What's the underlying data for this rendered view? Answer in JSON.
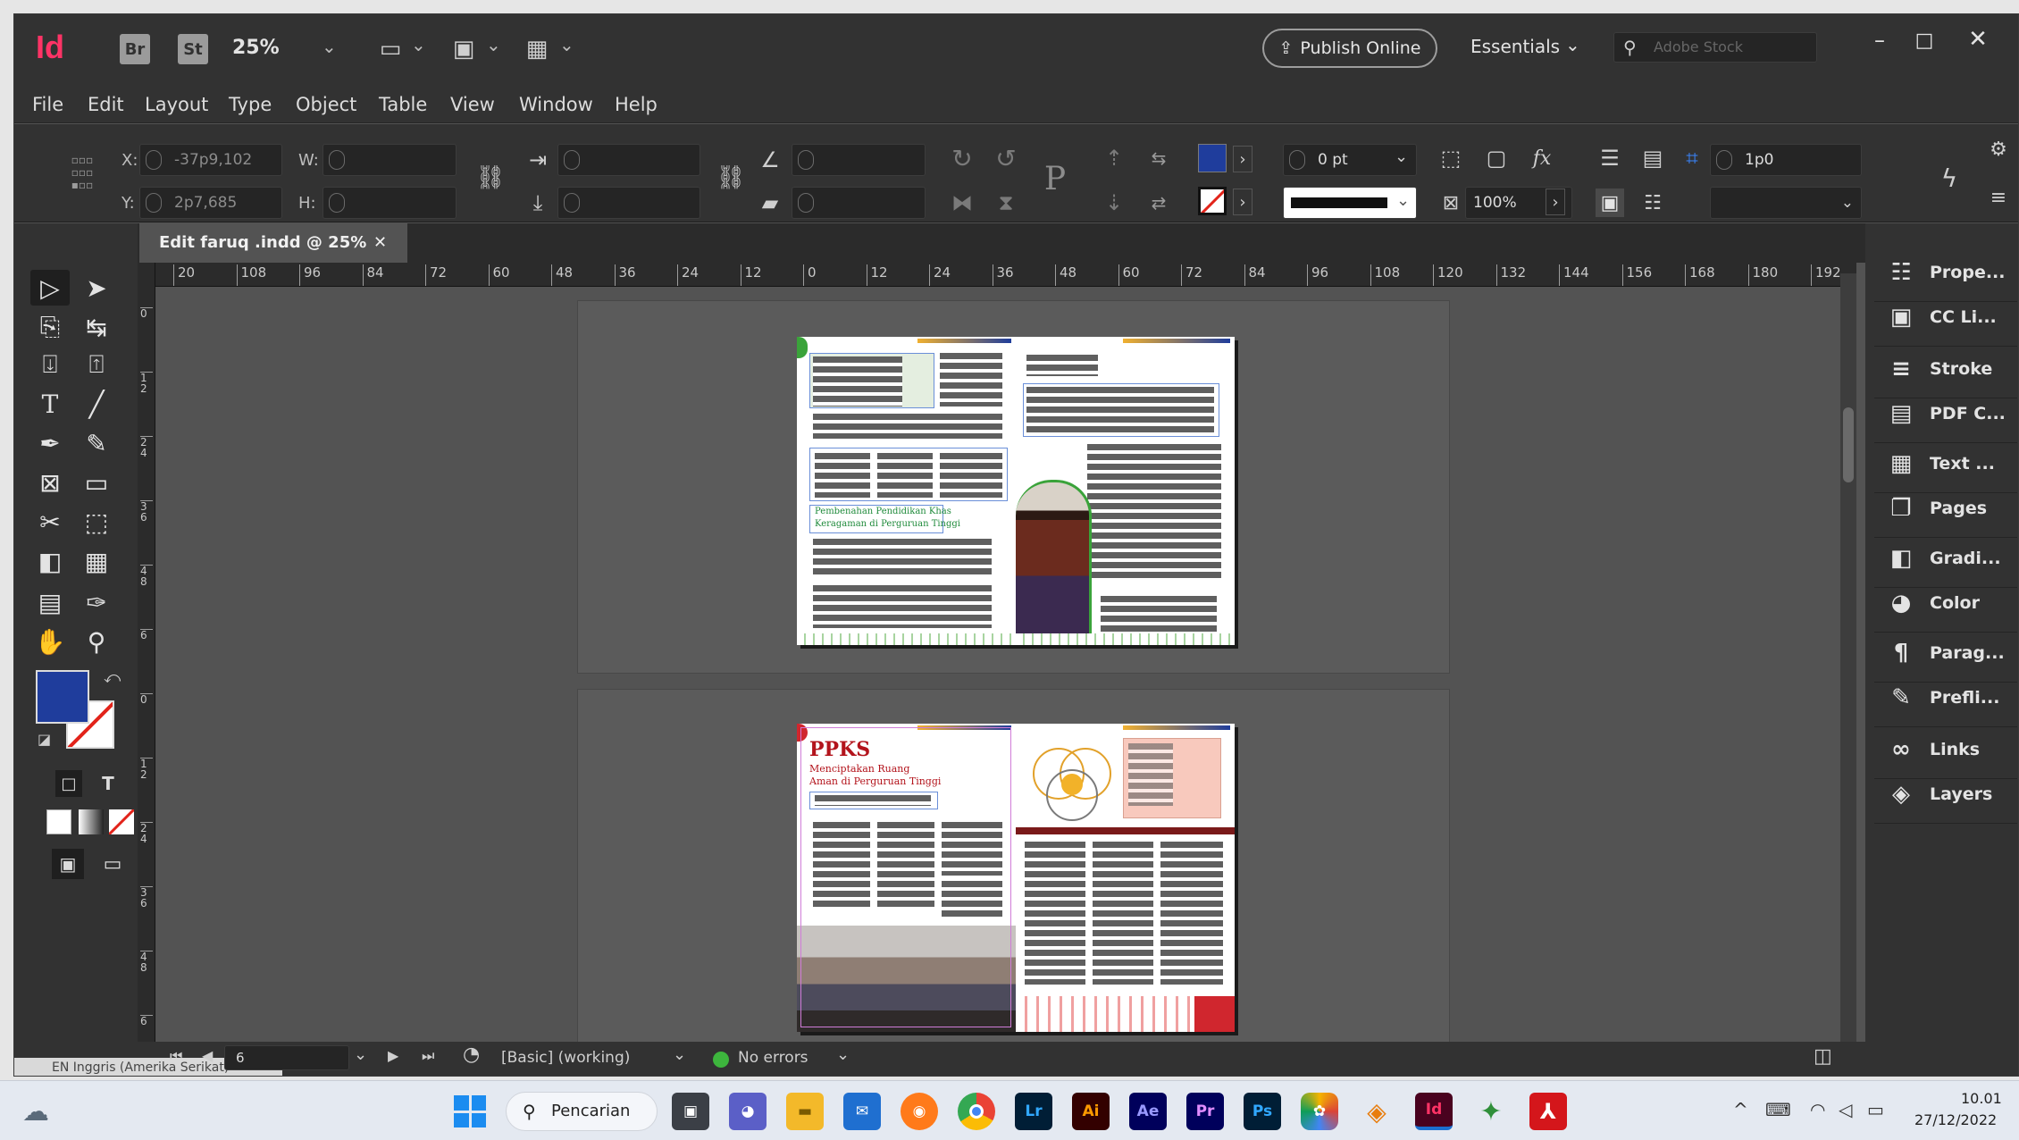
{
  "app": {
    "logo": "Id",
    "bridge": "Br",
    "stock": "St",
    "zoom": "25%",
    "publish": "Publish Online",
    "workspace": "Essentials",
    "search_placeholder": "Adobe Stock"
  },
  "menu": [
    "File",
    "Edit",
    "Layout",
    "Type",
    "Object",
    "Table",
    "View",
    "Window",
    "Help"
  ],
  "control": {
    "x_label": "X:",
    "x_value": "-37p9,102",
    "y_label": "Y:",
    "y_value": "2p7,685",
    "w_label": "W:",
    "h_label": "H:",
    "stroke_weight": "0 pt",
    "scale": "100%",
    "gutter": "1p0"
  },
  "document": {
    "tab": "Edit faruq .indd @ 25%"
  },
  "ruler": {
    "h_ticks": [
      "20",
      "108",
      "96",
      "84",
      "72",
      "60",
      "48",
      "36",
      "24",
      "12",
      "0",
      "12",
      "24",
      "36",
      "48",
      "60",
      "72",
      "84",
      "96",
      "108",
      "120",
      "132",
      "144",
      "156",
      "168",
      "180",
      "192"
    ],
    "v_ticks": [
      "0",
      "1 2",
      "2 4",
      "3 6",
      "4 8",
      "6",
      "0",
      "1 2",
      "2 4",
      "3 6",
      "4 8",
      "6"
    ]
  },
  "pages": {
    "headline2": "PPKS",
    "subhead2a": "Menciptakan Ruang",
    "subhead2b": "Aman di Perguruan Tinggi",
    "caption1a": "Pembenahan Pendidikan Khas",
    "caption1b": "Keragaman di Perguruan Tinggi"
  },
  "panels": [
    {
      "icon": "properties-icon",
      "label": "Prope..."
    },
    {
      "icon": "cc-libraries-icon",
      "label": "CC Li..."
    },
    {
      "icon": "stroke-icon",
      "label": "Stroke"
    },
    {
      "icon": "pdf-comments-icon",
      "label": "PDF C..."
    },
    {
      "icon": "text-wrap-icon",
      "label": "Text ..."
    },
    {
      "icon": "pages-icon",
      "label": "Pages"
    },
    {
      "icon": "gradient-icon",
      "label": "Gradi..."
    },
    {
      "icon": "color-icon",
      "label": "Color"
    },
    {
      "icon": "paragraph-icon",
      "label": "Parag..."
    },
    {
      "icon": "preflight-icon",
      "label": "Prefli..."
    },
    {
      "icon": "links-icon",
      "label": "Links"
    },
    {
      "icon": "layers-icon",
      "label": "Layers"
    }
  ],
  "status": {
    "page": "6",
    "style": "[Basic] (working)",
    "preflight": "No errors",
    "language": "EN Inggris (Amerika Serikat)"
  },
  "taskbar": {
    "search": "Pencarian",
    "time": "10.01",
    "date": "27/12/2022",
    "apps": [
      "Lr",
      "Ai",
      "Ae",
      "Pr",
      "Ps",
      "Id"
    ]
  },
  "colors": {
    "fill": "#1f3d9c",
    "indesign": "#ff3366",
    "accent": "#0a5fd8"
  }
}
